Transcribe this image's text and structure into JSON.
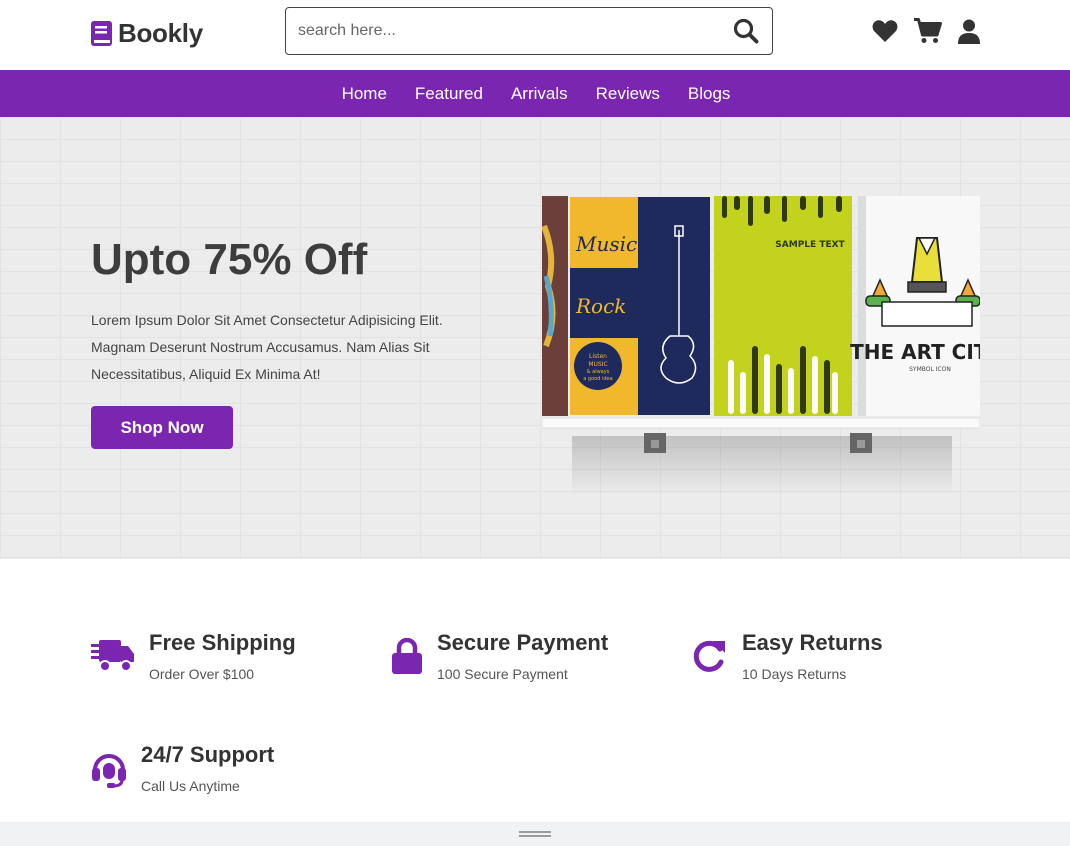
{
  "header": {
    "brand": "Bookly",
    "search": {
      "placeholder": "search here...",
      "value": ""
    },
    "icons": [
      "heart-icon",
      "cart-icon",
      "user-icon"
    ]
  },
  "nav": {
    "items": [
      "Home",
      "Featured",
      "Arrivals",
      "Reviews",
      "Blogs"
    ]
  },
  "hero": {
    "title": "Upto 75% Off",
    "description": "Lorem Ipsum Dolor Sit Amet Consectetur Adipisicing Elit. Magnam Deserunt Nostrum Accusamus. Nam Alias Sit Necessitatibus, Aliquid Ex Minima At!",
    "button_label": "Shop Now",
    "books": {
      "music": {
        "line1": "Music",
        "line2": "Rock",
        "badge1": "Listen",
        "badge2": "MUSIC",
        "badge3": "& always",
        "badge4": "a good idea"
      },
      "sample": "SAMPLE TEXT",
      "art_title": "THE ART CITY",
      "art_sub": "SYMBOL ICON"
    }
  },
  "features": [
    {
      "title": "Free Shipping",
      "subtitle": "Order Over $100",
      "icon": "truck-icon"
    },
    {
      "title": "Secure Payment",
      "subtitle": "100 Secure Payment",
      "icon": "lock-icon"
    },
    {
      "title": "Easy Returns",
      "subtitle": "10 Days Returns",
      "icon": "redo-icon"
    },
    {
      "title": "24/7 Support",
      "subtitle": "Call Us Anytime",
      "icon": "headset-icon"
    }
  ],
  "colors": {
    "brand": "#7b26b0",
    "text": "#333333",
    "hero_bg": "#ececec"
  }
}
